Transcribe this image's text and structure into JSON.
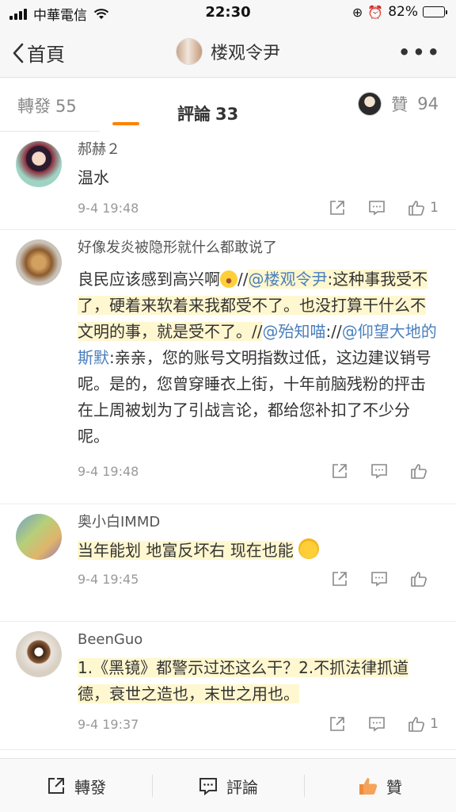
{
  "status_bar": {
    "carrier": "中華電信",
    "time": "22:30",
    "battery_percent": "82%",
    "battery_level": 0.82
  },
  "nav": {
    "back_label": "首頁",
    "title": "楼观令尹"
  },
  "tabs": {
    "repost_label": "轉發",
    "repost_count": "55",
    "comment_label": "評論",
    "comment_count": "33",
    "likes_label": "贊",
    "likes_count": "94"
  },
  "comments": [
    {
      "username": "郝赫２",
      "text": "温水",
      "time": "9-4 19:48",
      "likes": "1"
    },
    {
      "username": "好像发炎被隐形就什么都敢说了",
      "text_part1": "良民应该感到高兴啊",
      "text_part2": "//",
      "mention1": "@楼观令尹",
      "text_part3": ":这种事我受不了，硬着来软着来我都受不了。也没打算干什么不文明的事，就是受不了。//",
      "mention2": "@殆知喵",
      "text_part4": "://",
      "mention3": "@仰望大地的斯默",
      "text_part5": ":亲亲，您的账号文明指数过低，这边建议销号呢。是的，您曾穿睡衣上街，十年前脑残粉的抨击在上周被划为了引战言论，都给您补扣了不少分呢。",
      "time": "9-4 19:48",
      "likes": ""
    },
    {
      "username": "奥小白IMMD",
      "text": "当年能划 地富反坏右 现在也能",
      "time": "9-4 19:45",
      "likes": ""
    },
    {
      "username": "BeenGuo",
      "text": "1.《黑镜》都警示过还这么干？2.不抓法律抓道德，衰世之造也，末世之用也。",
      "time": "9-4 19:37",
      "likes": "1"
    }
  ],
  "bottom_bar": {
    "repost": "轉發",
    "comment": "評論",
    "like": "贊"
  },
  "colors": {
    "accent": "#ff8200",
    "mention": "#4a7fbd",
    "highlight": "#fff7cf"
  }
}
